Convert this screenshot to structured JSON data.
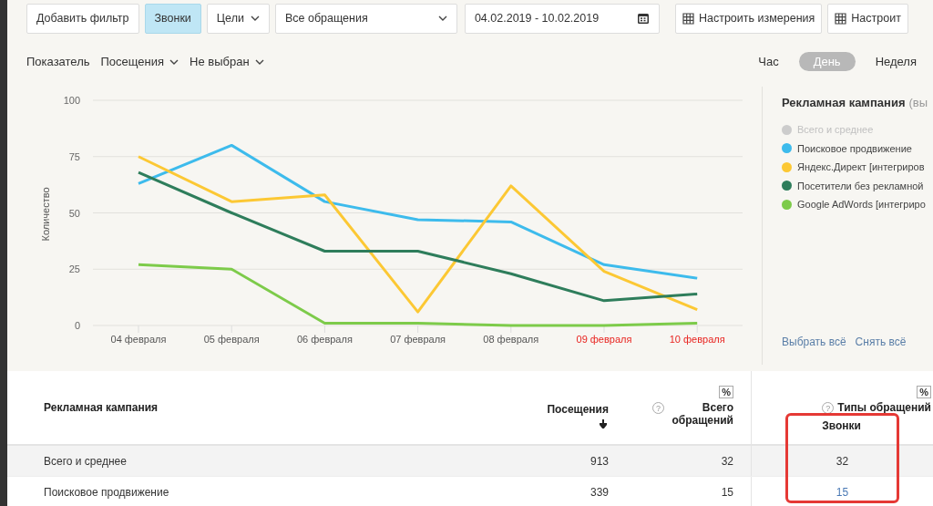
{
  "toolbar": {
    "items": [
      {
        "kind": "button",
        "label": "Добавить фильтр",
        "selected": false
      },
      {
        "kind": "button",
        "label": "Звонки",
        "selected": true
      },
      {
        "kind": "dropdown",
        "label": "Цели"
      },
      {
        "kind": "select",
        "label": "Все обращения"
      },
      {
        "kind": "date",
        "label": "04.02.2019 - 10.02.2019"
      },
      {
        "kind": "grid",
        "label": "Настроить измерения"
      },
      {
        "kind": "grid",
        "label": "Настроит"
      }
    ]
  },
  "controls": {
    "label": "Показатель",
    "dropdowns": [
      "Посещения",
      "Не выбран"
    ],
    "periods": [
      {
        "label": "Час",
        "selected": false
      },
      {
        "label": "День",
        "selected": true
      },
      {
        "label": "Неделя",
        "selected": false
      }
    ]
  },
  "chart": {
    "weekend": [
      false,
      false,
      false,
      false,
      false,
      true,
      true
    ],
    "chart_data": {
      "type": "line",
      "ylabel": "Количество",
      "categories": [
        "04 февраля",
        "05 февраля",
        "06 февраля",
        "07 февраля",
        "08 февраля",
        "09 февраля",
        "10 февраля"
      ],
      "ylim": [
        0,
        100
      ],
      "grid": true,
      "yticks": [
        0,
        25,
        50,
        75,
        100
      ],
      "series": [
        {
          "color": "#3dbbec",
          "values": [
            63,
            80,
            55,
            47,
            46,
            27,
            21
          ]
        },
        {
          "color": "#fcc834",
          "values": [
            75,
            55,
            58,
            6,
            62,
            24,
            7
          ]
        },
        {
          "color": "#2e7d5b",
          "values": [
            68,
            50,
            33,
            33,
            23,
            11,
            14
          ]
        },
        {
          "color": "#7dcb4a",
          "values": [
            27,
            25,
            1,
            1,
            0,
            0,
            1
          ]
        }
      ]
    }
  },
  "legend": {
    "title": "Рекламная кампания",
    "title_note": "(вы",
    "items": [
      {
        "name": "Всего и среднее",
        "color": "#cccccc",
        "enabled": false
      },
      {
        "name": "Поисковое продвижение",
        "color": "#3dbbec",
        "enabled": true
      },
      {
        "name": "Яндекс.Директ [интегриров",
        "color": "#fcc834",
        "enabled": true
      },
      {
        "name": "Посетители без рекламной",
        "color": "#2e7d5b",
        "enabled": true
      },
      {
        "name": "Google AdWords [интегриро",
        "color": "#7dcb4a",
        "enabled": true
      }
    ],
    "links": [
      "Выбрать всё",
      "Снять всё"
    ]
  },
  "table": {
    "columns": [
      {
        "title": "Рекламная кампания"
      },
      {
        "title": "Посещения",
        "sorted": true
      },
      {
        "title": "Всего обращений",
        "percent": "%",
        "help": "?"
      },
      {
        "title": "Типы обращений",
        "percent": "%",
        "help": "?",
        "sub": "Звонки"
      }
    ],
    "rows": [
      {
        "cells": [
          "Всего и среднее",
          "913",
          "32",
          "32"
        ],
        "total": true
      },
      {
        "cells": [
          "Поисковое продвижение",
          "339",
          "15",
          "15"
        ],
        "total": false
      }
    ]
  }
}
